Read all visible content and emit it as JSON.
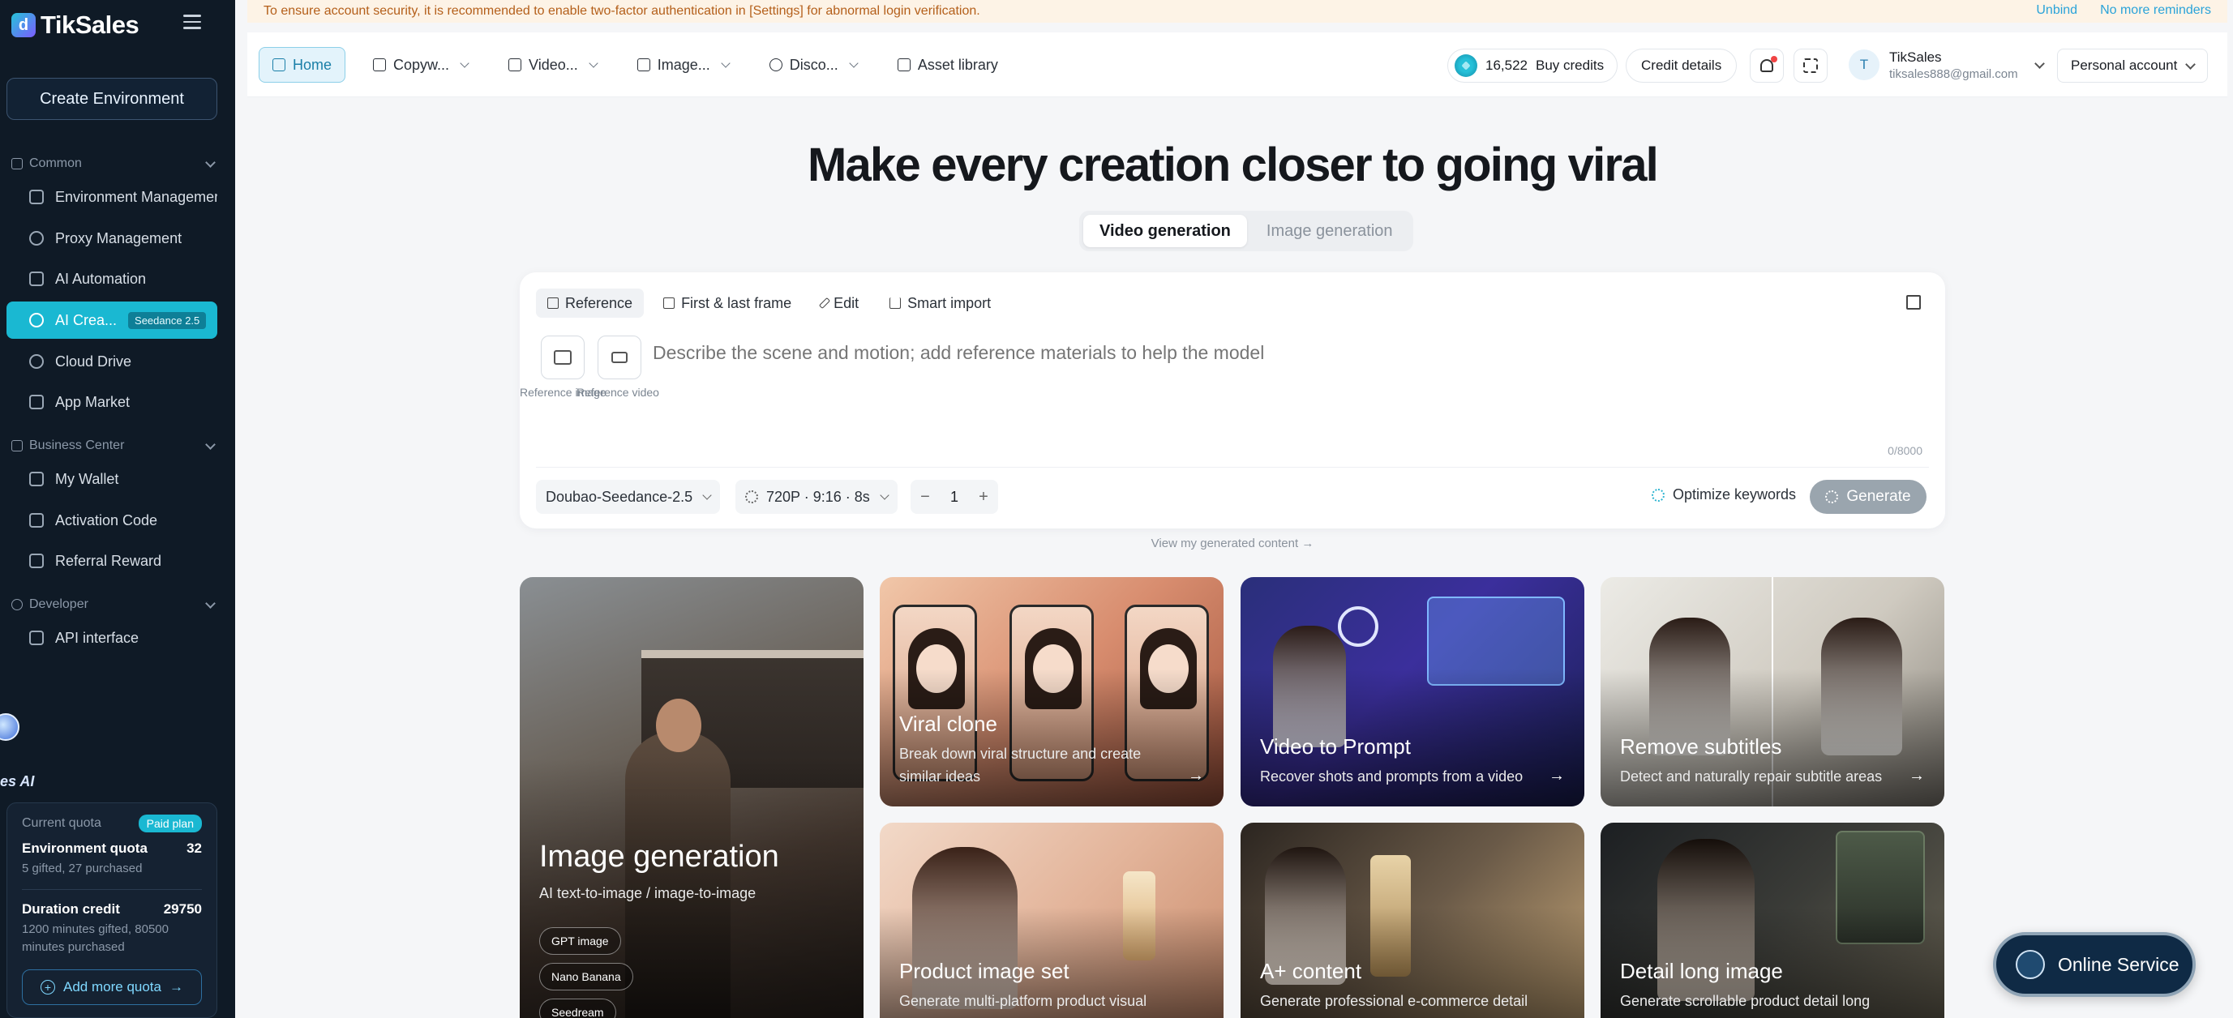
{
  "app": {
    "name": "TikSales"
  },
  "sidebar": {
    "create_env": "Create Environment",
    "groups": {
      "common": "Common",
      "business": "Business Center",
      "developer": "Developer"
    },
    "items": [
      {
        "label": "Environment Managemer"
      },
      {
        "label": "Proxy Management"
      },
      {
        "label": "AI Automation"
      },
      {
        "label": "AI Crea...",
        "badge": "Seedance 2.5"
      },
      {
        "label": "Cloud Drive"
      },
      {
        "label": "App Market"
      },
      {
        "label": "My Wallet"
      },
      {
        "label": "Activation Code"
      },
      {
        "label": "Referral Reward"
      },
      {
        "label": "API interface"
      }
    ],
    "mascot_label": "es AI",
    "quota": {
      "current_label": "Current quota",
      "plan_badge": "Paid plan",
      "env_title": "Environment quota",
      "env_value": "32",
      "env_sub": "5 gifted, 27 purchased",
      "duration_title": "Duration credit",
      "duration_value": "29750",
      "duration_sub": "1200 minutes gifted, 80500 minutes purchased",
      "add_button": "Add more quota",
      "add_arrow": "→"
    }
  },
  "notice": {
    "text": "To ensure account security, it is recommended to enable two-factor authentication in [Settings] for abnormal login verification.",
    "unbind": "Unbind",
    "dismiss": "No more reminders"
  },
  "header": {
    "nav": [
      {
        "label": "Home"
      },
      {
        "label": "Copyw..."
      },
      {
        "label": "Video..."
      },
      {
        "label": "Image..."
      },
      {
        "label": "Disco..."
      },
      {
        "label": "Asset library"
      }
    ],
    "credits_value": "16,522",
    "buy_credits": "Buy credits",
    "credit_details": "Credit details",
    "user": {
      "initial": "T",
      "name": "TikSales",
      "email": "tiksales888@gmail.com"
    },
    "account": "Personal account"
  },
  "main": {
    "title": "Make every creation closer to going viral",
    "modes": [
      "Video generation",
      "Image generation"
    ],
    "composer": {
      "tabs": [
        "Reference",
        "First & last frame",
        "Edit",
        "Smart import"
      ],
      "ref_image_caption": "Reference image",
      "ref_video_caption": "Reference video",
      "placeholder": "Describe the scene and motion; add reference materials to help the model",
      "counter": "0/8000",
      "model": "Doubao-Seedance-2.5",
      "settings": "720P · 9:16 · 8s",
      "quantity_minus": "−",
      "quantity": "1",
      "quantity_plus": "+",
      "optimize": "Optimize keywords",
      "generate": "Generate"
    },
    "view_generated": "View my generated content →",
    "cards": {
      "image_gen": {
        "title": "Image generation",
        "desc": "AI text-to-image / image-to-image",
        "tags": [
          "GPT image",
          "Nano Banana",
          "Seedream"
        ]
      },
      "viral": {
        "title": "Viral clone",
        "desc": "Break down viral structure and create similar ideas",
        "arrow": "→"
      },
      "prompt": {
        "title": "Video to Prompt",
        "desc": "Recover shots and prompts from a video",
        "arrow": "→"
      },
      "subtitles": {
        "title": "Remove subtitles",
        "desc": "Detect and naturally repair subtitle areas",
        "arrow": "→"
      },
      "product": {
        "title": "Product image set",
        "desc": "Generate multi-platform product visual"
      },
      "aplus": {
        "title": "A+ content",
        "desc": "Generate professional e-commerce detail"
      },
      "detail": {
        "title": "Detail long image",
        "desc": "Generate scrollable product detail long"
      }
    }
  },
  "service": {
    "label": "Online Service"
  }
}
